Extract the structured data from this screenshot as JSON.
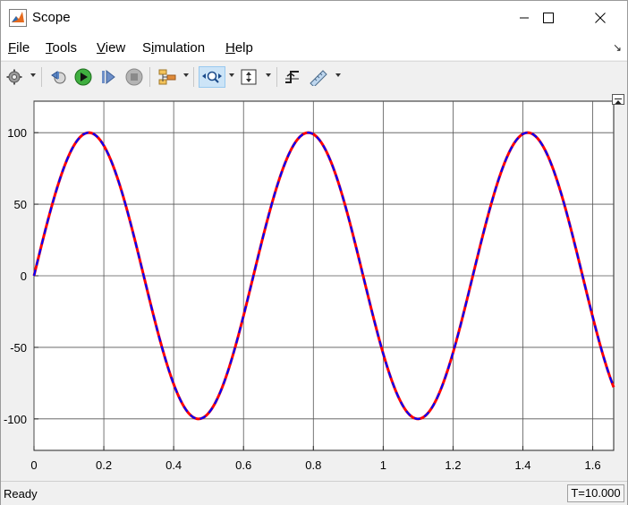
{
  "window": {
    "title": "Scope"
  },
  "window_controls": [
    "minimize-icon",
    "maximize-icon",
    "close-icon"
  ],
  "menu": [
    {
      "label": "File",
      "mnemonic": "F"
    },
    {
      "label": "Tools",
      "mnemonic": "T"
    },
    {
      "label": "View",
      "mnemonic": "V"
    },
    {
      "label": "Simulation",
      "mnemonic": "i"
    },
    {
      "label": "Help",
      "mnemonic": "H"
    }
  ],
  "toolbar": {
    "icons": [
      "settings-gear-icon",
      "step-back-icon",
      "run-icon",
      "step-forward-icon",
      "stop-icon",
      "signal-hierarchy-icon",
      "zoom-icon",
      "autoscale-icon",
      "trigger-icon",
      "measure-icon"
    ],
    "active": "zoom-icon"
  },
  "chart_data": {
    "type": "line",
    "title": "",
    "xlabel": "",
    "ylabel": "",
    "xlim": [
      0,
      1.66
    ],
    "ylim": [
      -122,
      122
    ],
    "xticks": [
      "0",
      "0.2",
      "0.4",
      "0.6",
      "0.8",
      "1",
      "1.2",
      "1.4",
      "1.6"
    ],
    "xtick_values": [
      0,
      0.2,
      0.4,
      0.6,
      0.8,
      1.0,
      1.2,
      1.4,
      1.6
    ],
    "yticks": [
      "100",
      "50",
      "0",
      "-50",
      "-100"
    ],
    "ytick_values": [
      100,
      50,
      0,
      -50,
      -100
    ],
    "grid": true,
    "background": "#ffffff",
    "series": [
      {
        "style": "solid",
        "color": "#ff0000",
        "amplitude": 100,
        "frequency_rad_per_s": 10
      },
      {
        "style": "dashed",
        "color": "#0000ff",
        "amplitude": 100,
        "frequency_rad_per_s": 10
      }
    ]
  },
  "status": {
    "text": "Ready",
    "time": "T=10.000"
  }
}
